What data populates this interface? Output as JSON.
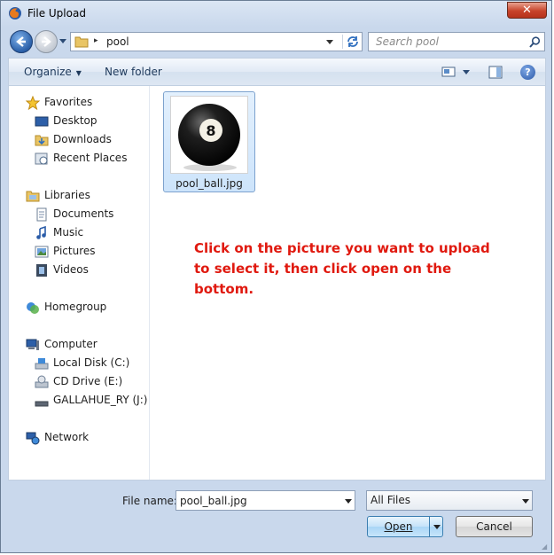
{
  "window": {
    "title": "File Upload",
    "close_label": "✕"
  },
  "address": {
    "separator": "▸",
    "current": "pool",
    "search_placeholder": "Search pool"
  },
  "toolbar": {
    "organize_label": "Organize",
    "new_folder_label": "New folder",
    "help_label": "?"
  },
  "navigation": {
    "favorites_header": "Favorites",
    "favorites": [
      "Desktop",
      "Downloads",
      "Recent Places"
    ],
    "libraries_header": "Libraries",
    "libraries": [
      "Documents",
      "Music",
      "Pictures",
      "Videos"
    ],
    "homegroup": "Homegroup",
    "computer_header": "Computer",
    "drives": [
      "Local Disk (C:)",
      "CD Drive (E:)",
      "GALLAHUE_RY (J:)"
    ],
    "network": "Network"
  },
  "files": [
    {
      "name": "pool_ball.jpg",
      "selected": true,
      "thumbnail_number": "8"
    }
  ],
  "instruction": {
    "line1": "Click on the picture you want to upload",
    "line2": "to select it, then click open on the bottom."
  },
  "bottom": {
    "file_name_label": "File name:",
    "file_name_value": "pool_ball.jpg",
    "file_type_value": "All Files",
    "open_label": "Open",
    "cancel_label": "Cancel"
  },
  "colors": {
    "instruction_text": "#e0190f",
    "selection_fill": "#cde4fb",
    "selection_border": "#7da2ce"
  }
}
